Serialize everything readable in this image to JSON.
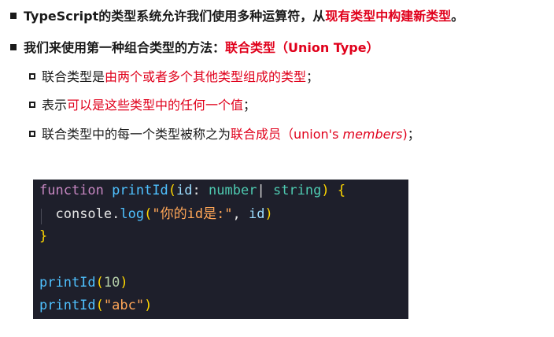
{
  "bullets": [
    {
      "prefix": "TypeScript的类型系统允许我们使用多种运算符，从",
      "highlight": "现有类型中构建新类型",
      "suffix": "。"
    },
    {
      "prefix": "我们来使用第一种组合类型的方法：",
      "highlight": "联合类型（Union Type）",
      "suffix": ""
    }
  ],
  "sub_items": [
    {
      "prefix": "联合类型是",
      "highlight": "由两个或者多个其他类型组成的类型",
      "suffix": "；"
    },
    {
      "prefix": "表示",
      "highlight": "可以是这些类型中的任何一个值",
      "suffix": "；"
    },
    {
      "prefix": "联合类型中的每一个类型被称之为",
      "highlight": "联合成员（union's ",
      "highlight_italic": "members",
      "highlight_end": ")",
      "suffix": "；"
    }
  ],
  "code": {
    "line1": {
      "kw": "function",
      "fn": "printId",
      "open": "(",
      "param": "id",
      "colon": ":",
      "type1": "number",
      "pipe": "|",
      "type2": "string",
      "close": ")",
      "brace": "{"
    },
    "line2": {
      "obj": "console",
      "dot": ".",
      "method": "log",
      "open": "(",
      "str": "\"你的id是:\"",
      "comma": ",",
      "arg": "id",
      "close": ")"
    },
    "line3": {
      "brace": "}"
    },
    "line5": {
      "fn": "printId",
      "open": "(",
      "num": "10",
      "close": ")"
    },
    "line6": {
      "fn": "printId",
      "open": "(",
      "str": "\"abc\"",
      "close": ")"
    }
  },
  "colors": {
    "accent_red": "#e0001b",
    "code_bg": "#1e1f2b"
  }
}
